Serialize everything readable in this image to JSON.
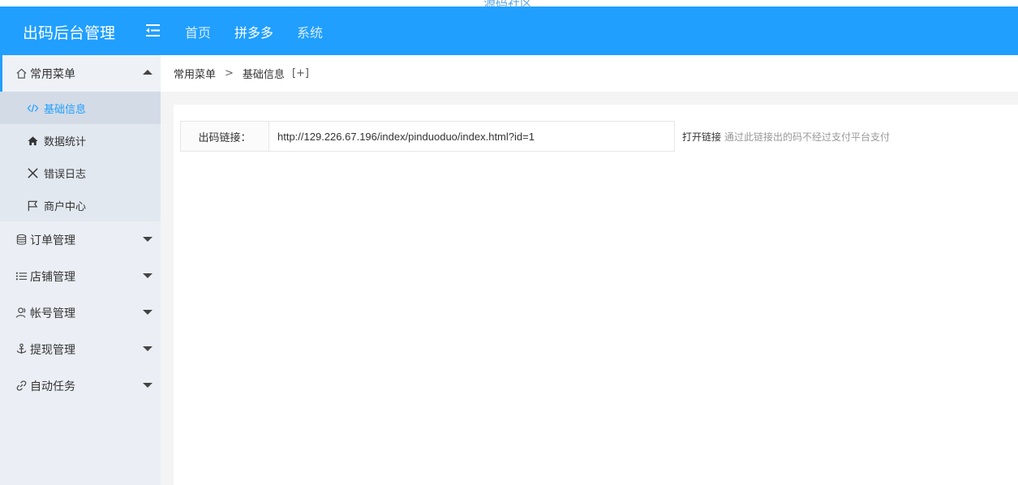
{
  "watermark": "源码社区",
  "header": {
    "title": "出码后台管理",
    "nav": [
      "首页",
      "拼多多",
      "系统"
    ]
  },
  "sidebar": {
    "groups": [
      {
        "label": "常用菜单",
        "icon": "home-icon",
        "expanded": true,
        "items": [
          {
            "label": "基础信息",
            "icon": "code-icon",
            "active": true
          },
          {
            "label": "数据统计",
            "icon": "house-filled-icon"
          },
          {
            "label": "错误日志",
            "icon": "close-icon"
          },
          {
            "label": "商户中心",
            "icon": "flag-icon"
          }
        ]
      },
      {
        "label": "订单管理",
        "icon": "database-icon"
      },
      {
        "label": "店铺管理",
        "icon": "list-icon"
      },
      {
        "label": "帐号管理",
        "icon": "user-icon"
      },
      {
        "label": "提现管理",
        "icon": "anchor-icon"
      },
      {
        "label": "自动任务",
        "icon": "link-icon"
      }
    ]
  },
  "breadcrumb": {
    "parent": "常用菜单",
    "separator": ">",
    "current": "基础信息",
    "toggle": "[+]"
  },
  "form": {
    "label": "出码链接：",
    "value": "http://129.226.67.196/index/pinduoduo/index.html?id=1",
    "open_link": "打开链接",
    "hint": "通过此链接出的码不经过支付平台支付"
  },
  "colors": {
    "accent": "#209fff",
    "sidebar_bg": "#ebeff5"
  }
}
